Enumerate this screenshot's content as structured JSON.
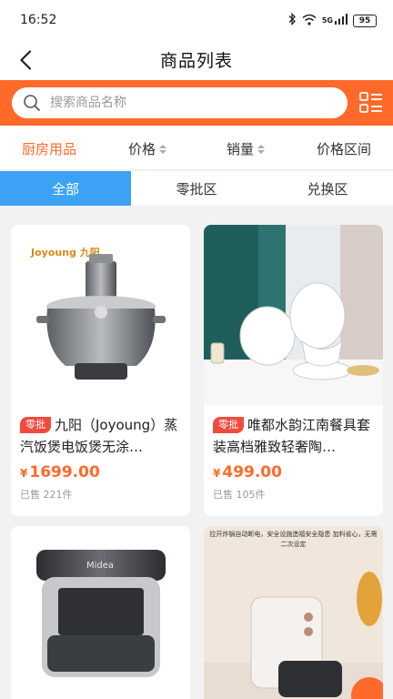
{
  "status_bar": {
    "time": "16:52",
    "network": "5G",
    "battery": "95"
  },
  "header": {
    "title": "商品列表"
  },
  "search": {
    "placeholder": "搜索商品名称"
  },
  "filters": {
    "category": "厨房用品",
    "price": "价格",
    "sales": "销量",
    "price_range": "价格区间"
  },
  "segments": [
    "全部",
    "零批区",
    "兑换区"
  ],
  "products": [
    {
      "tag": "零批",
      "name": "九阳（Joyoung）蒸汽饭煲电饭煲无涂…",
      "currency": "¥",
      "price": "1699.00",
      "sold": "已售 221件",
      "brand_mark": "Joyoung 九阳"
    },
    {
      "tag": "零批",
      "name": "唯都水韵江南餐具套装高档雅致轻奢陶…",
      "currency": "¥",
      "price": "499.00",
      "sold": "已售 105件"
    },
    {
      "brand_mark": "Midea"
    },
    {
      "overlay_text": "拉开炸锅自动断电，安全设施造福安全隐患 加料省心，无需二次设定"
    }
  ],
  "colors": {
    "accent": "#ff6a2b",
    "segment_active": "#3ba2f5",
    "tag": "#f14a3c"
  }
}
